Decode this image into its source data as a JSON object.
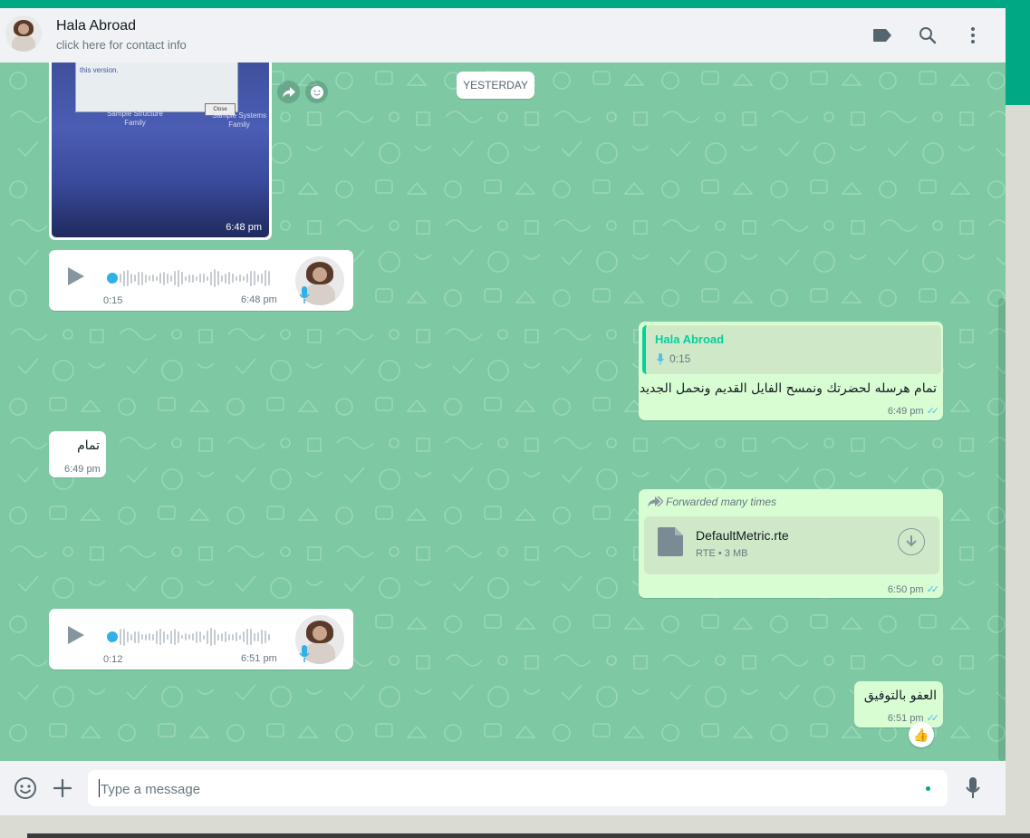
{
  "header": {
    "contact_name": "Hala Abroad",
    "contact_sub": "click here for contact info",
    "icons": [
      "label-icon",
      "search-icon",
      "menu-icon"
    ]
  },
  "chat": {
    "day_label": "YESTERDAY",
    "image_message": {
      "time": "6:48 pm",
      "dialog_text": "this version.",
      "dialog_close": "Close",
      "label_left": "Sample Structure\nFamily",
      "label_right": "Sample Systems\nFamily"
    },
    "voice1": {
      "duration": "0:15",
      "time": "6:48 pm"
    },
    "reply_message": {
      "quote_name": "Hala Abroad",
      "quote_duration": "0:15",
      "text": "تمام هرسله لحضرتك ونمسح الفايل القديم ونحمل الجديد",
      "time": "6:49 pm"
    },
    "in_text": {
      "text": "تمام",
      "time": "6:49 pm"
    },
    "file_message": {
      "forwarded_label": "Forwarded many times",
      "file_name": "DefaultMetric.rte",
      "file_info": "RTE • 3 MB",
      "time": "6:50 pm"
    },
    "voice2": {
      "duration": "0:12",
      "time": "6:51 pm"
    },
    "last_out": {
      "text": "العفو بالتوفيق",
      "time": "6:51 pm",
      "reaction": "👍"
    }
  },
  "footer": {
    "input_placeholder": "Type a message",
    "icons": [
      "emoji-icon",
      "attach-plus-icon",
      "microphone-icon"
    ]
  },
  "colors": {
    "accent": "#00a884",
    "chat_bg": "#7ec8a4",
    "outgoing": "#d9fdd3",
    "incoming": "#ffffff",
    "read_ticks": "#53bdeb"
  }
}
